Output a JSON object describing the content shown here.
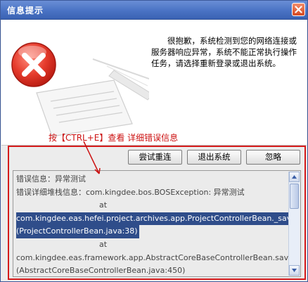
{
  "dialog": {
    "title": "信息提示",
    "message": "很抱歉，系统检测到您的网络连接或服务器响应异常，系统不能正常执行操作任务，请选择重新登录或退出系统。"
  },
  "annotation": {
    "hint": "按【CTRL+E】查看 详细错误信息",
    "color": "#cc1111"
  },
  "buttons": {
    "retry": "尝试重连",
    "exit": "退出系统",
    "ignore": "忽略"
  },
  "details": {
    "lines": [
      "错误信息：异常测试",
      "错误详细堆栈信息：com.kingdee.bos.BOSException: 异常测试",
      "at",
      "com.kingdee.eas.hefei.project.archives.app.ProjectControllerBean._save",
      "(ProjectControllerBean.java:38)",
      "at",
      "com.kingdee.eas.framework.app.AbstractCoreBaseControllerBean.save",
      "(AbstractCoreBaseControllerBean.java:450)"
    ]
  },
  "icons": {
    "error": "error-x-icon",
    "close": "close-icon"
  }
}
